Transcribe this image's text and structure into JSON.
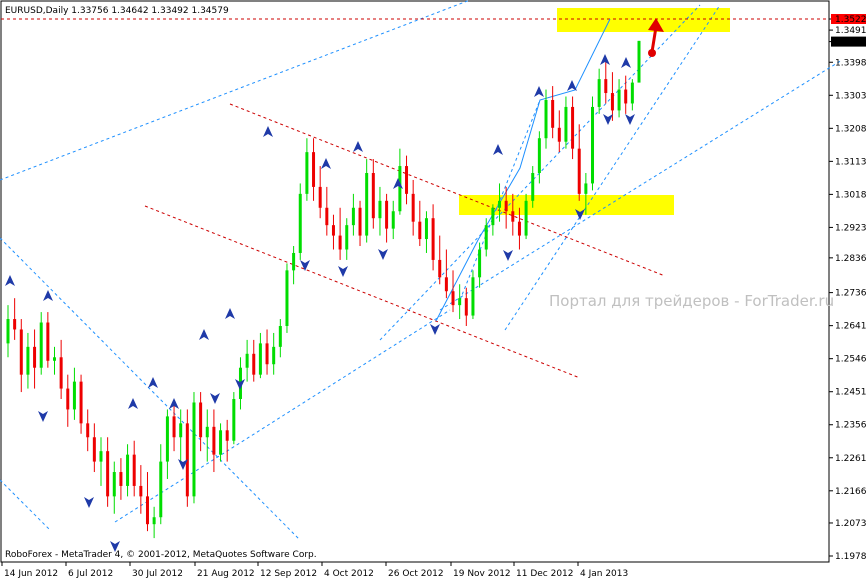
{
  "chart_data": {
    "type": "candlestick",
    "symbol_header": "EURUSD,Daily  1.33756 1.34642 1.33492 1.34579",
    "y_ticks": [
      {
        "label": "1.35229",
        "value": 1.35229,
        "highlight": "red"
      },
      {
        "label": "1.34910",
        "value": 1.3491
      },
      {
        "label": "1.34579",
        "value": 1.34579,
        "highlight": "black"
      },
      {
        "label": "1.33985",
        "value": 1.33985
      },
      {
        "label": "1.33035",
        "value": 1.33035
      },
      {
        "label": "1.32085",
        "value": 1.32085
      },
      {
        "label": "1.31135",
        "value": 1.31135
      },
      {
        "label": "1.30185",
        "value": 1.30185
      },
      {
        "label": "1.29235",
        "value": 1.29235
      },
      {
        "label": "1.28360",
        "value": 1.2836
      },
      {
        "label": "1.27360",
        "value": 1.2736
      },
      {
        "label": "1.26410",
        "value": 1.2641
      },
      {
        "label": "1.25460",
        "value": 1.2546
      },
      {
        "label": "1.24510",
        "value": 1.2451
      },
      {
        "label": "1.23560",
        "value": 1.2356
      },
      {
        "label": "1.22610",
        "value": 1.2261
      },
      {
        "label": "1.21660",
        "value": 1.2166
      },
      {
        "label": "1.20735",
        "value": 1.20735
      },
      {
        "label": "1.19785",
        "value": 1.19785
      }
    ],
    "x_labels": [
      "14 Jun 2012",
      "6 Jul 2012",
      "30 Jul 2012",
      "21 Aug 2012",
      "12 Sep 2012",
      "4 Oct 2012",
      "26 Oct 2012",
      "19 Nov 2012",
      "11 Dec 2012",
      "4 Jan 2013"
    ],
    "ohlc": [
      [
        1.259,
        1.27,
        1.255,
        1.266
      ],
      [
        1.266,
        1.272,
        1.26,
        1.263
      ],
      [
        1.263,
        1.266,
        1.245,
        1.25
      ],
      [
        1.25,
        1.262,
        1.246,
        1.258
      ],
      [
        1.258,
        1.263,
        1.246,
        1.252
      ],
      [
        1.252,
        1.268,
        1.25,
        1.265
      ],
      [
        1.265,
        1.268,
        1.252,
        1.254
      ],
      [
        1.254,
        1.258,
        1.25,
        1.255
      ],
      [
        1.255,
        1.26,
        1.243,
        1.246
      ],
      [
        1.246,
        1.25,
        1.235,
        1.24
      ],
      [
        1.24,
        1.252,
        1.237,
        1.248
      ],
      [
        1.248,
        1.25,
        1.233,
        1.236
      ],
      [
        1.236,
        1.24,
        1.228,
        1.232
      ],
      [
        1.232,
        1.236,
        1.222,
        1.225
      ],
      [
        1.225,
        1.232,
        1.218,
        1.228
      ],
      [
        1.228,
        1.232,
        1.212,
        1.215
      ],
      [
        1.215,
        1.225,
        1.21,
        1.222
      ],
      [
        1.222,
        1.226,
        1.214,
        1.218
      ],
      [
        1.218,
        1.23,
        1.215,
        1.227
      ],
      [
        1.227,
        1.231,
        1.215,
        1.218
      ],
      [
        1.218,
        1.224,
        1.21,
        1.215
      ],
      [
        1.215,
        1.222,
        1.205,
        1.207
      ],
      [
        1.207,
        1.212,
        1.203,
        1.209
      ],
      [
        1.209,
        1.23,
        1.207,
        1.225
      ],
      [
        1.225,
        1.24,
        1.22,
        1.238
      ],
      [
        1.238,
        1.242,
        1.228,
        1.232
      ],
      [
        1.232,
        1.24,
        1.225,
        1.236
      ],
      [
        1.236,
        1.24,
        1.212,
        1.215
      ],
      [
        1.215,
        1.245,
        1.213,
        1.242
      ],
      [
        1.242,
        1.245,
        1.228,
        1.232
      ],
      [
        1.232,
        1.24,
        1.225,
        1.235
      ],
      [
        1.235,
        1.24,
        1.222,
        1.227
      ],
      [
        1.227,
        1.236,
        1.225,
        1.234
      ],
      [
        1.234,
        1.237,
        1.225,
        1.231
      ],
      [
        1.231,
        1.245,
        1.23,
        1.243
      ],
      [
        1.243,
        1.255,
        1.24,
        1.252
      ],
      [
        1.252,
        1.26,
        1.248,
        1.256
      ],
      [
        1.256,
        1.26,
        1.248,
        1.25
      ],
      [
        1.25,
        1.262,
        1.249,
        1.259
      ],
      [
        1.259,
        1.263,
        1.25,
        1.253
      ],
      [
        1.253,
        1.262,
        1.25,
        1.258
      ],
      [
        1.258,
        1.266,
        1.255,
        1.264
      ],
      [
        1.264,
        1.282,
        1.262,
        1.28
      ],
      [
        1.28,
        1.287,
        1.276,
        1.285
      ],
      [
        1.285,
        1.305,
        1.283,
        1.302
      ],
      [
        1.302,
        1.318,
        1.3,
        1.314
      ],
      [
        1.314,
        1.318,
        1.3,
        1.304
      ],
      [
        1.304,
        1.31,
        1.295,
        1.298
      ],
      [
        1.298,
        1.304,
        1.29,
        1.293
      ],
      [
        1.293,
        1.296,
        1.286,
        1.29
      ],
      [
        1.29,
        1.298,
        1.283,
        1.286
      ],
      [
        1.286,
        1.295,
        1.283,
        1.293
      ],
      [
        1.293,
        1.302,
        1.29,
        1.298
      ],
      [
        1.298,
        1.3,
        1.287,
        1.29
      ],
      [
        1.29,
        1.312,
        1.288,
        1.308
      ],
      [
        1.308,
        1.312,
        1.292,
        1.295
      ],
      [
        1.295,
        1.304,
        1.29,
        1.3
      ],
      [
        1.3,
        1.302,
        1.288,
        1.292
      ],
      [
        1.292,
        1.3,
        1.289,
        1.297
      ],
      [
        1.297,
        1.315,
        1.296,
        1.31
      ],
      [
        1.31,
        1.313,
        1.299,
        1.302
      ],
      [
        1.302,
        1.306,
        1.29,
        1.294
      ],
      [
        1.294,
        1.3,
        1.287,
        1.289
      ],
      [
        1.289,
        1.297,
        1.285,
        1.295
      ],
      [
        1.295,
        1.299,
        1.28,
        1.283
      ],
      [
        1.283,
        1.29,
        1.276,
        1.278
      ],
      [
        1.278,
        1.286,
        1.272,
        1.274
      ],
      [
        1.274,
        1.28,
        1.268,
        1.27
      ],
      [
        1.27,
        1.276,
        1.266,
        1.272
      ],
      [
        1.272,
        1.275,
        1.264,
        1.267
      ],
      [
        1.267,
        1.28,
        1.266,
        1.278
      ],
      [
        1.278,
        1.288,
        1.275,
        1.286
      ],
      [
        1.286,
        1.295,
        1.284,
        1.293
      ],
      [
        1.293,
        1.299,
        1.29,
        1.298
      ],
      [
        1.298,
        1.305,
        1.294,
        1.3
      ],
      [
        1.3,
        1.304,
        1.292,
        1.297
      ],
      [
        1.297,
        1.302,
        1.29,
        1.294
      ],
      [
        1.294,
        1.298,
        1.286,
        1.29
      ],
      [
        1.29,
        1.302,
        1.289,
        1.3
      ],
      [
        1.3,
        1.31,
        1.298,
        1.308
      ],
      [
        1.308,
        1.32,
        1.305,
        1.318
      ],
      [
        1.318,
        1.332,
        1.315,
        1.329
      ],
      [
        1.329,
        1.333,
        1.318,
        1.321
      ],
      [
        1.321,
        1.326,
        1.314,
        1.317
      ],
      [
        1.317,
        1.33,
        1.315,
        1.327
      ],
      [
        1.327,
        1.33,
        1.312,
        1.315
      ],
      [
        1.315,
        1.322,
        1.3,
        1.302
      ],
      [
        1.302,
        1.308,
        1.296,
        1.305
      ],
      [
        1.305,
        1.33,
        1.303,
        1.327
      ],
      [
        1.327,
        1.338,
        1.325,
        1.335
      ],
      [
        1.335,
        1.34,
        1.328,
        1.331
      ],
      [
        1.331,
        1.337,
        1.323,
        1.326
      ],
      [
        1.326,
        1.335,
        1.324,
        1.332
      ],
      [
        1.332,
        1.336,
        1.325,
        1.328
      ],
      [
        1.328,
        1.335,
        1.326,
        1.334
      ],
      [
        1.334,
        1.346,
        1.335,
        1.346
      ]
    ],
    "watermark": "Портал для трейдеров - ForTrader.ru",
    "footer": "RoboForex - MetaTrader 4, © 2001-2012, MetaQuotes Software Corp.",
    "colors": {
      "bull": "#00dd00",
      "bear": "#ee0000",
      "channel_blue": "#1e90ff",
      "channel_red": "#cc0000",
      "zone": "#ffff00",
      "fractal": "#1f3aa8"
    }
  }
}
